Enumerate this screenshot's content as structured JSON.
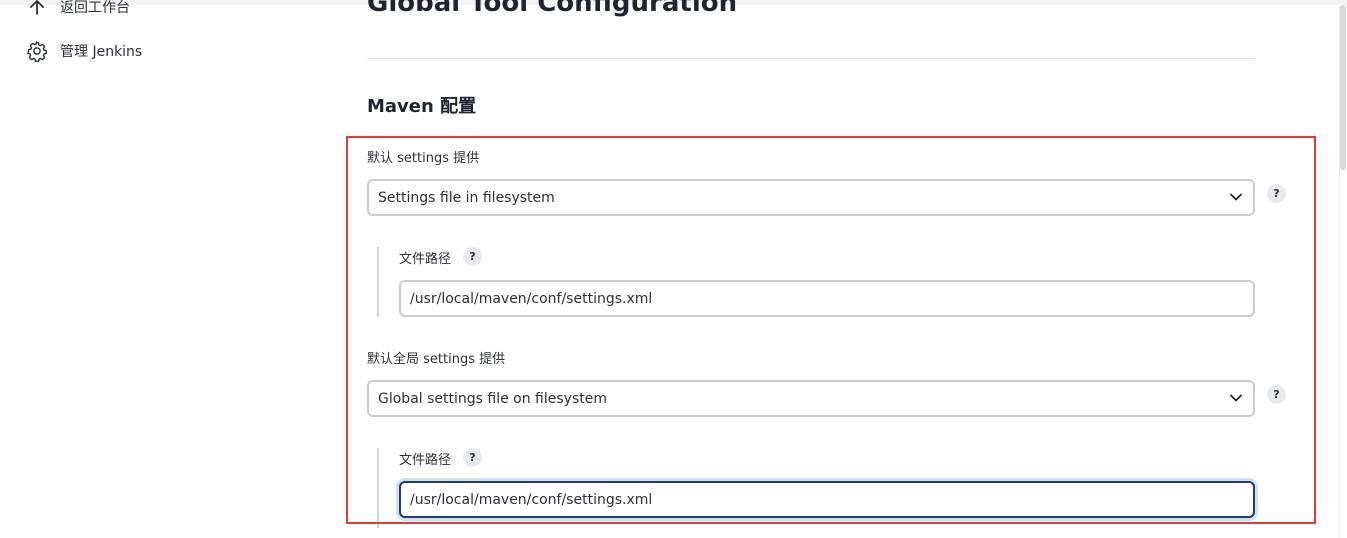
{
  "sidebar": {
    "items": [
      {
        "label": "返回工作台",
        "icon": "arrow-up-icon"
      },
      {
        "label": "管理 Jenkins",
        "icon": "gear-icon"
      }
    ]
  },
  "main": {
    "title": "Global Tool Configuration",
    "section_title": "Maven 配置",
    "default_settings": {
      "label": "默认 settings 提供",
      "selected": "Settings file in filesystem",
      "help": "?",
      "path_label": "文件路径",
      "path_help": "?",
      "path_value": "/usr/local/maven/conf/settings.xml"
    },
    "global_settings": {
      "label": "默认全局 settings 提供",
      "selected": "Global settings file on filesystem",
      "help": "?",
      "path_label": "文件路径",
      "path_help": "?",
      "path_value": "/usr/local/maven/conf/settings.xml"
    }
  },
  "colors": {
    "highlight": "#e53935",
    "focus_border": "#1f3f66",
    "input_border": "#c9cdd2"
  }
}
